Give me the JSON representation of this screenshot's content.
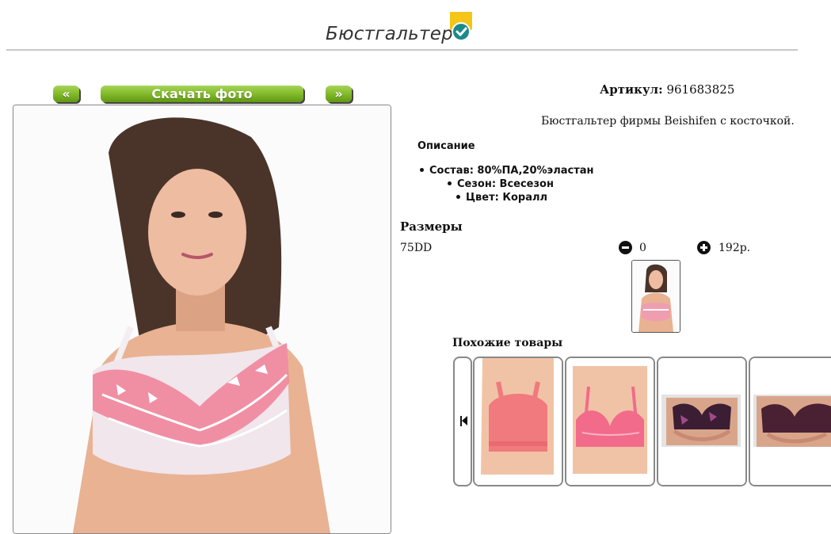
{
  "header": {
    "title": "Бюстгальтер",
    "badge_icon": "verified-check-icon",
    "badge_color": "#f5c518",
    "check_color": "#1b8a8a"
  },
  "gallery": {
    "prev_label": "«",
    "next_label": "»",
    "download_label": "Скачать фото",
    "button_color": "#7ab42a"
  },
  "product": {
    "sku_label": "Артикул:",
    "sku_value": "961683825",
    "description": "Бюстгальтер фирмы Beishifen с косточкой.",
    "description_heading": "Описание",
    "properties": [
      "Состав: 80%ПА,20%эластан",
      "Сезон: Всесезон",
      "Цвет: Коралл"
    ]
  },
  "sizes": {
    "heading": "Размеры",
    "rows": [
      {
        "size": "75DD",
        "quantity": "0",
        "price": "192р."
      }
    ],
    "minus_icon": "minus-circle-icon",
    "plus_icon": "plus-circle-icon"
  },
  "similar": {
    "heading": "Похожие товары",
    "prev_icon": "skip-back-icon",
    "items": [
      {
        "color": "#f07a7e"
      },
      {
        "color": "#f26b8a"
      },
      {
        "color": "#3b1e33"
      },
      {
        "color": "#4a2033"
      }
    ]
  }
}
